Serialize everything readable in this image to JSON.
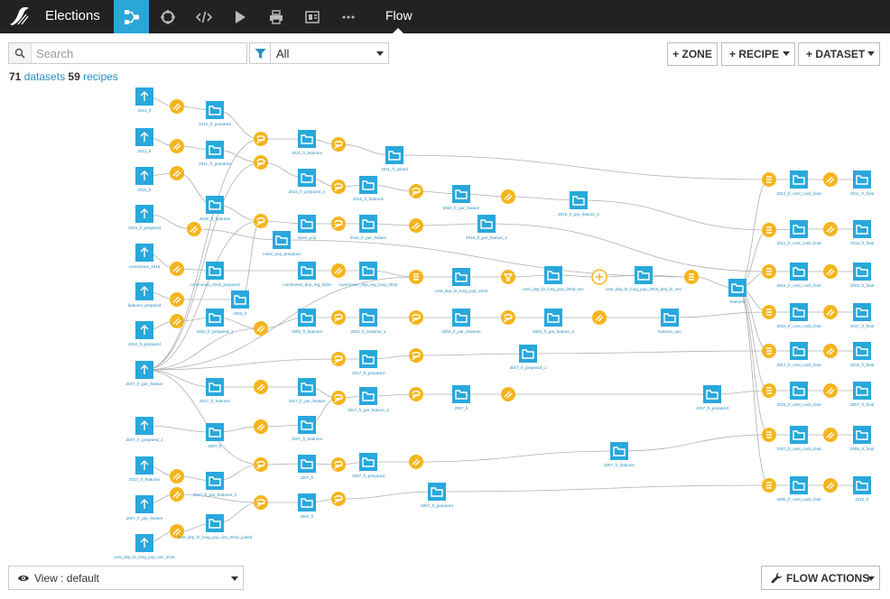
{
  "app": {
    "project_title": "Elections",
    "active_view_label": "Flow"
  },
  "nav": [
    {
      "name": "flow-nav-icon",
      "active": true
    },
    {
      "name": "lab-nav-icon",
      "active": false
    },
    {
      "name": "code-nav-icon",
      "active": false
    },
    {
      "name": "run-nav-icon",
      "active": false
    },
    {
      "name": "print-nav-icon",
      "active": false
    },
    {
      "name": "dashboard-nav-icon",
      "active": false
    },
    {
      "name": "more-nav-icon",
      "active": false
    }
  ],
  "toolbar": {
    "search_placeholder": "Search",
    "filter_value": "All",
    "zone_label": "+ ZONE",
    "recipe_label": "+ RECIPE",
    "dataset_label": "+ DATASET"
  },
  "counts": {
    "datasets": "71",
    "datasets_label": "datasets",
    "recipes": "59",
    "recipes_label": "recipes"
  },
  "footer": {
    "view_label": "View : default",
    "flow_actions_label": "FLOW ACTIONS"
  },
  "colors": {
    "topbar": "#222222",
    "accent": "#2aa6d7",
    "dataset": "#29a8dc",
    "recipe": "#f5b51c"
  },
  "flow": {
    "datasets": [
      {
        "label": "2012_fr"
      },
      {
        "label": "2012_fr_prepared"
      },
      {
        "label": "2011_fr"
      },
      {
        "label": "2011_fr_prepared"
      },
      {
        "label": "2011_fr_features"
      },
      {
        "label": "2011_fr_joined"
      },
      {
        "label": "2015_fr"
      },
      {
        "label": "2015_fr_prepared_1"
      },
      {
        "label": "2015_fr_features"
      },
      {
        "label": "2015_fr_par_feature"
      },
      {
        "label": "2015_fr_par_feature_2"
      },
      {
        "label": "2016_fr_prepared"
      },
      {
        "label": "2016_fr_features"
      },
      {
        "label": "insee_pop"
      },
      {
        "label": "2016_fr_par_feature"
      },
      {
        "label": "2016_fr_par_feature_2"
      },
      {
        "label": "insee_pop_prepared"
      },
      {
        "label": "communes_2016"
      },
      {
        "label": "communes_2016_prepared"
      },
      {
        "label": "communes_dep_reg_2016"
      },
      {
        "label": "communes_dep_reg_long_2016"
      },
      {
        "label": "cent_dep_fe_long_pop_2016"
      },
      {
        "label": "cent_dep_fe_long_pop_2016_sec"
      },
      {
        "label": "cent_dep_fe_long_pop_2016_dep_fe_sec"
      },
      {
        "label": "features"
      },
      {
        "label": "features_prepared"
      },
      {
        "label": "2002_fr"
      },
      {
        "label": "2002_fr_prepared"
      },
      {
        "label": "2002_fr_prepared_1"
      },
      {
        "label": "2002_fr_features"
      },
      {
        "label": "2002_fr_features_1"
      },
      {
        "label": "2002_fr_par_features"
      },
      {
        "label": "2002_fr_par_feature_2"
      },
      {
        "label": "features_join"
      },
      {
        "label": "2007_fr_par_feature"
      },
      {
        "label": "2017_fr_prepared"
      },
      {
        "label": "2017_fr_prepared_1"
      },
      {
        "label": "2017_fr_features"
      },
      {
        "label": "2017_fr_par_feature"
      },
      {
        "label": "2017_fr_par_feature_2"
      },
      {
        "label": "2007_fr"
      },
      {
        "label": "2007_fr_prepared"
      },
      {
        "label": "2007_fr_prepared_1"
      },
      {
        "label": "2007_fr"
      },
      {
        "label": "2007_fr_features"
      },
      {
        "label": "2017_fr_features"
      },
      {
        "label": "2017_fr_par_features_2"
      },
      {
        "label": "2007_fr"
      },
      {
        "label": "2007_fr_prepared"
      },
      {
        "label": "2007_fr_features"
      },
      {
        "label": "2007_fr_par_feature"
      },
      {
        "label": "2007_fr"
      },
      {
        "label": "2007_fr_prepared"
      },
      {
        "label": "cent_dep_fe_long_pop_sec_2016"
      },
      {
        "label": "cent_dep_fe_long_pop_sec_2016_joined"
      },
      {
        "label": "2012_fr_cent_cods_final"
      },
      {
        "label": "2011_fr_final"
      },
      {
        "label": "2011_fr_cent_cods_final"
      },
      {
        "label": "2016_fr_final"
      },
      {
        "label": "2016_fr_cent_cods_final"
      },
      {
        "label": "2002_fr_final"
      },
      {
        "label": "2002_fr_cent_cods_final"
      },
      {
        "label": "2017_fr_final"
      },
      {
        "label": "2017_fr_cent_cods_final"
      },
      {
        "label": "2015_fr_final"
      },
      {
        "label": "2015_fr_cent_cods_final"
      },
      {
        "label": "2007_fr_final"
      },
      {
        "label": "2007_fr_cent_cods_final"
      },
      {
        "label": "2005_fr_final"
      },
      {
        "label": "2005_fr_cent_cods_final"
      }
    ]
  }
}
